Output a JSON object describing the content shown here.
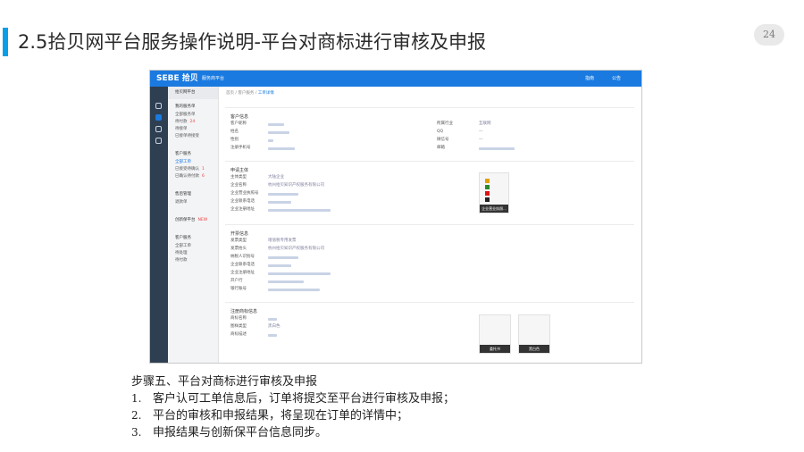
{
  "slide": {
    "title": "2.5拾贝网平台服务操作说明-平台对商标进行审核及申报",
    "page_number": "24"
  },
  "app": {
    "logo": "SEBE 拾贝",
    "logo_sub": "服务商平台",
    "top_links": [
      "指南",
      "公告"
    ],
    "breadcrumb": [
      "首页",
      "客户服务",
      "工单详情"
    ]
  },
  "sidebar": {
    "platform": "拾贝网平台",
    "groups": [
      {
        "title": "我的服务单",
        "items": [
          {
            "label": "全部服务单"
          },
          {
            "label": "待付款",
            "count": "24"
          },
          {
            "label": "待接单"
          },
          {
            "label": "已接单待接受"
          }
        ]
      },
      {
        "title": "客户服务",
        "items": [
          {
            "label": "全部工单",
            "active": true
          },
          {
            "label": "已接受待确认",
            "count": "1"
          },
          {
            "label": "已确认待付款",
            "count": "6"
          }
        ]
      },
      {
        "title": "售后管理",
        "items": [
          {
            "label": "退款单"
          }
        ]
      },
      {
        "title": "创新保平台",
        "badge": "NEW"
      },
      {
        "title": "客户服务",
        "items": [
          {
            "label": "全部工单"
          },
          {
            "label": "待处理"
          },
          {
            "label": "待付款"
          }
        ]
      }
    ]
  },
  "customer_info": {
    "title": "客户信息",
    "left": [
      {
        "label": "客户昵称"
      },
      {
        "label": "姓名"
      },
      {
        "label": "性别"
      },
      {
        "label": "注册手机号"
      }
    ],
    "right": [
      {
        "label": "所属行业",
        "value": "互联网"
      },
      {
        "label": "QQ",
        "value": "—"
      },
      {
        "label": "微信号",
        "value": "—"
      },
      {
        "label": "邮箱"
      }
    ]
  },
  "applicant": {
    "title": "申请主体",
    "rows": [
      {
        "label": "主体类型",
        "value": "大陆企业"
      },
      {
        "label": "企业名称",
        "value": "杭州拾贝知识产权服务有限公司"
      },
      {
        "label": "企业营业执照号"
      },
      {
        "label": "企业联系电话"
      },
      {
        "label": "企业注册地址"
      }
    ],
    "thumb_caption": "企业营业执照..."
  },
  "invoice": {
    "title": "开票信息",
    "rows": [
      {
        "label": "发票类型",
        "value": "增值税专用发票"
      },
      {
        "label": "发票抬头",
        "value": "杭州拾贝知识产权服务有限公司"
      },
      {
        "label": "纳税人识别号"
      },
      {
        "label": "企业联系电话"
      },
      {
        "label": "企业注册地址"
      },
      {
        "label": "开户行"
      },
      {
        "label": "银行账号"
      }
    ]
  },
  "trademark": {
    "title": "注册商标信息",
    "rows": [
      {
        "label": "商标名称"
      },
      {
        "label": "图样类型",
        "value": "黑白色"
      },
      {
        "label": "商标描述"
      }
    ],
    "thumbs": [
      "委托书",
      "黑白色"
    ]
  },
  "steps": {
    "heading": "步骤五、平台对商标进行审核及申报",
    "items": [
      {
        "num": "1.",
        "text": "客户认可工单信息后，订单将提交至平台进行审核及申报；"
      },
      {
        "num": "2.",
        "text": "平台的审核和申报结果，将呈现在订单的详情中；"
      },
      {
        "num": "3.",
        "text": "申报结果与创新保平台信息同步。"
      }
    ]
  },
  "colors": {
    "accent": "#0b9ee8",
    "app_header": "#1a7ae0",
    "icon_column": "#2f3f52"
  }
}
